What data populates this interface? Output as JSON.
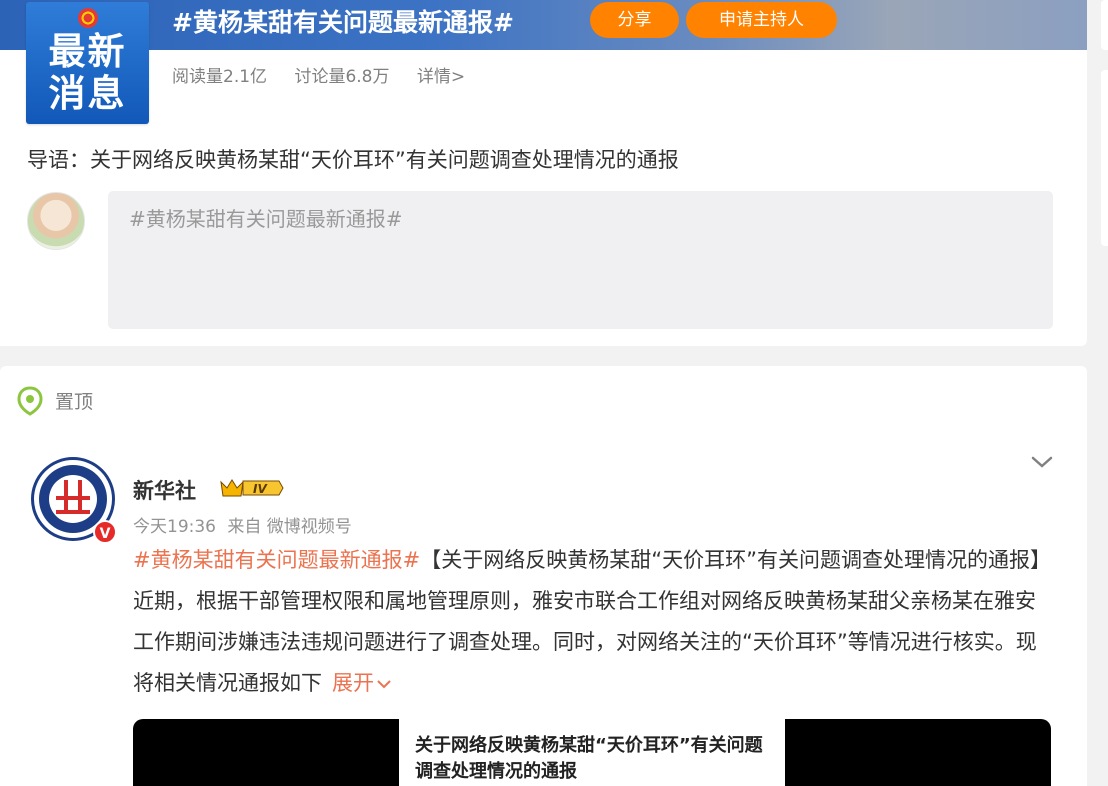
{
  "topic": {
    "cover_line1": "最新",
    "cover_line2": "消息",
    "title": "#黄杨某甜有关问题最新通报#",
    "share_label": "分享",
    "host_label": "申请主持人",
    "reads": "阅读量2.1亿",
    "discussions": "讨论量6.8万",
    "details": "详情>",
    "intro": "导语：关于网络反映黄杨某甜“天价耳环”有关问题调查处理情况的通报",
    "composer_placeholder": "#黄杨某甜有关问题最新通报#"
  },
  "feed": {
    "pinned_label": "置顶",
    "post": {
      "author": "新华社",
      "level_badge": "IV",
      "avatar_text": "XINHUA",
      "verified": "V",
      "time": "今天19:36",
      "source": "来自 微博视频号",
      "hashtag": "#黄杨某甜有关问题最新通报#",
      "text": "【关于网络反映黄杨某甜“天价耳环”有关问题调查处理情况的通报】近期，根据干部管理权限和属地管理原则，雅安市联合工作组对网络反映黄杨某甜父亲杨某在雅安工作期间涉嫌违法违规问题进行了调查处理。同时，对网络关注的“天价耳环”等情况进行核实。现将相关情况通报如下",
      "expand_label": "展开",
      "video_title": "关于网络反映黄杨某甜“天价耳环”有关问题调查处理情况的通报"
    }
  },
  "colors": {
    "accent_orange": "#ff8200",
    "link_orange": "#eb7350",
    "banner_blue": "#2c63b7"
  }
}
